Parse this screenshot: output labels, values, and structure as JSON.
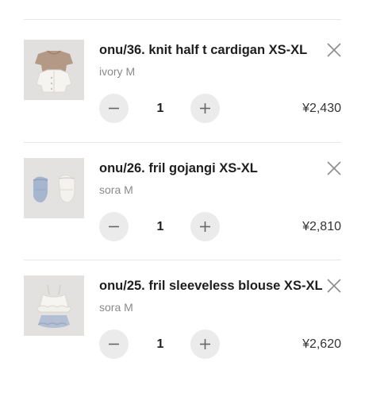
{
  "cart": {
    "items": [
      {
        "title": "onu/36. knit half t cardigan XS-XL",
        "variant": "ivory M",
        "quantity": "1",
        "price": "¥2,430",
        "thumbnail_icon": "knit-cardigan-product-photo"
      },
      {
        "title": "onu/26. fril gojangi XS-XL",
        "variant": "sora M",
        "quantity": "1",
        "price": "¥2,810",
        "thumbnail_icon": "fril-gojangi-product-photo"
      },
      {
        "title": "onu/25. fril sleeveless blouse XS-XL",
        "variant": "sora M",
        "quantity": "1",
        "price": "¥2,620",
        "thumbnail_icon": "sleeveless-blouse-product-photo"
      }
    ],
    "icons": {
      "remove": "close-icon",
      "decrement": "minus-icon",
      "increment": "plus-icon"
    },
    "colors": {
      "stepper_bg": "#ebebeb",
      "divider": "#e6e6e6",
      "variant_text": "#8a8a8a"
    }
  }
}
